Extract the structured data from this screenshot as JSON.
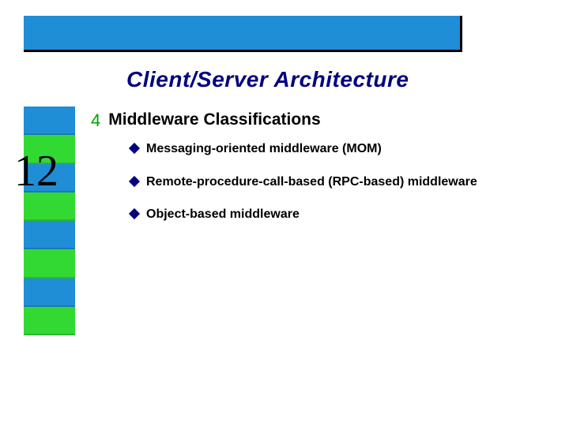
{
  "title": "Client/Server Architecture",
  "section_bullet_glyph": "4",
  "section_header": "Middleware Classifications",
  "slide_number": "12",
  "bullets": {
    "b0": "Messaging-oriented middleware (MOM)",
    "b1": "Remote-procedure-call-based (RPC-based) middleware",
    "b2": "Object-based middleware"
  },
  "colors": {
    "accent_blue": "#1f8ed6",
    "accent_green": "#33d933",
    "title_navy": "#000080"
  }
}
